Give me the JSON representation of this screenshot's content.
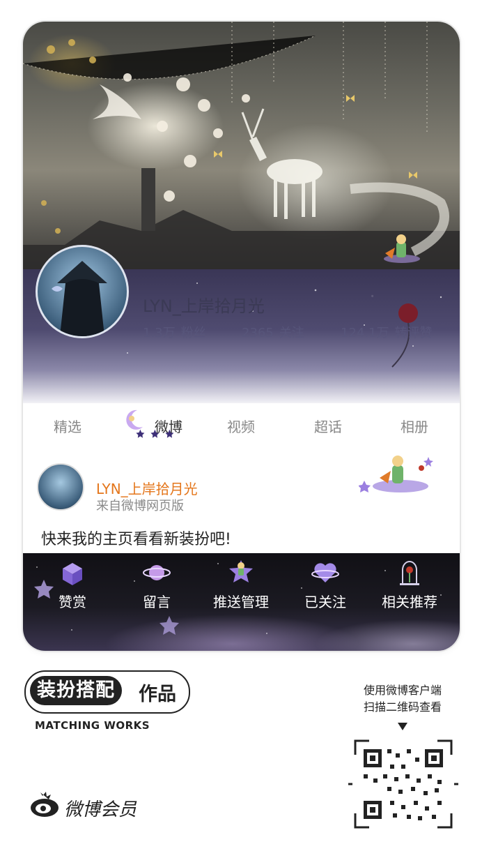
{
  "profile": {
    "username": "LYN_上岸拾月光",
    "stats": [
      {
        "value": "1.3万",
        "label": "粉丝"
      },
      {
        "value": "2365",
        "label": "关注"
      },
      {
        "value": "124.1万",
        "label": "转评赞"
      }
    ]
  },
  "tabs": [
    {
      "label": "精选",
      "active": false
    },
    {
      "label": "微博",
      "active": true
    },
    {
      "label": "视频",
      "active": false
    },
    {
      "label": "超话",
      "active": false
    },
    {
      "label": "相册",
      "active": false
    }
  ],
  "post": {
    "author": "LYN_上岸拾月光",
    "source": "来自微博网页版",
    "text": "快来我的主页看看新装扮吧!"
  },
  "actions": [
    {
      "label": "赞赏",
      "icon": "gift-box-icon"
    },
    {
      "label": "留言",
      "icon": "planet-icon"
    },
    {
      "label": "推送管理",
      "icon": "star-prince-icon"
    },
    {
      "label": "已关注",
      "icon": "heart-planet-icon"
    },
    {
      "label": "相关推荐",
      "icon": "rose-dome-icon"
    }
  ],
  "footer": {
    "brand_pill": "装扮搭配",
    "brand_suffix": "作品",
    "brand_en": "MATCHING WORKS",
    "vip_text": "微博会员",
    "qr_hint_line1": "使用微博客户端",
    "qr_hint_line2": "扫描二维码查看"
  },
  "colors": {
    "username": "#3b3a55",
    "post_author": "#e4761b",
    "action_label": "#ffffff"
  }
}
